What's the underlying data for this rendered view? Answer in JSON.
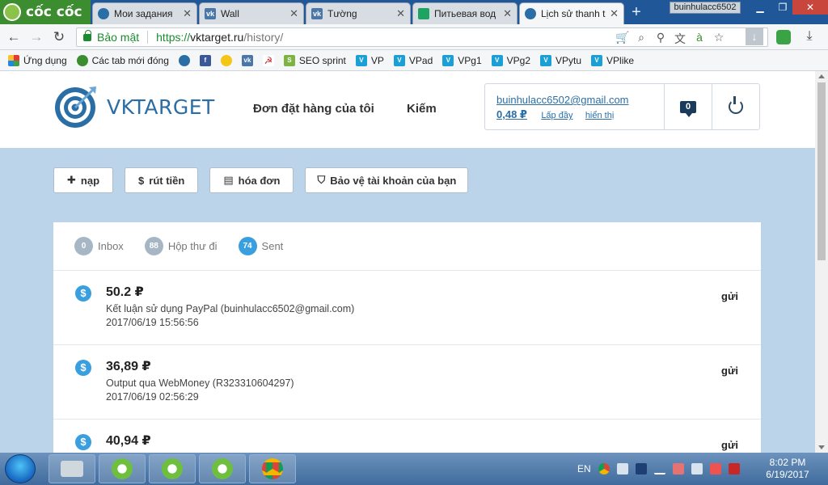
{
  "browser": {
    "logo_text": "cốc cốc",
    "tabs": [
      {
        "title": "Мои задания",
        "icon": "vktarget-icon"
      },
      {
        "title": "Wall",
        "icon": "vk-icon"
      },
      {
        "title": "Tường",
        "icon": "vk-icon"
      },
      {
        "title": "Питьевая вод",
        "icon": "sheets-icon"
      },
      {
        "title": "Lịch sử thanh t",
        "icon": "vktarget-icon"
      }
    ],
    "profile": "buinhulacc6502",
    "secure_label": "Bảo mật",
    "url_scheme": "https://",
    "url_host": "vktarget.ru",
    "url_path": "/history/"
  },
  "bookmarks": [
    {
      "label": "Ứng dụng",
      "icon": "apps-icon"
    },
    {
      "label": "Các tab mới đóng",
      "icon": "recent-tabs-icon"
    },
    {
      "label": "",
      "icon": "vktarget-icon"
    },
    {
      "label": "",
      "icon": "facebook-icon"
    },
    {
      "label": "",
      "icon": "yellow-app-icon"
    },
    {
      "label": "",
      "icon": "vk-icon"
    },
    {
      "label": "",
      "icon": "hammer-sickle-icon"
    },
    {
      "label": "SEO sprint",
      "icon": "seosprint-icon"
    },
    {
      "label": "VP",
      "icon": "v-icon"
    },
    {
      "label": "VPad",
      "icon": "v-icon"
    },
    {
      "label": "VPg1",
      "icon": "v-icon"
    },
    {
      "label": "VPg2",
      "icon": "v-icon"
    },
    {
      "label": "VPytu",
      "icon": "v-icon"
    },
    {
      "label": "VPlike",
      "icon": "v-icon"
    }
  ],
  "site": {
    "brand": "VKTARGET",
    "nav": [
      "Đơn đặt hàng của tôi",
      "Kiếm"
    ],
    "account": {
      "email": "buinhulacc6502@gmail.com",
      "balance": "0,48 ₽",
      "topup": "Lấp đầy",
      "show": "hiển thị",
      "messages": "0"
    },
    "actions": [
      {
        "label": "nạp",
        "icon": "plus-icon"
      },
      {
        "label": "rút tiền",
        "icon": "dollar-icon"
      },
      {
        "label": "hóa đơn",
        "icon": "document-icon"
      },
      {
        "label": "Bảo vệ tài khoản của bạn",
        "icon": "shield-icon"
      }
    ],
    "filters": [
      {
        "label": "Inbox",
        "count": "0",
        "color": "#a7b6c4"
      },
      {
        "label": "Hộp thư đi",
        "count": "88",
        "color": "#a7b6c4"
      },
      {
        "label": "Sent",
        "count": "74",
        "color": "#3a9fde"
      }
    ],
    "transactions": [
      {
        "amount": "50.2 ₽",
        "desc": "Kết luận sử dụng PayPal (buinhulacc6502@gmail.com)",
        "date": "2017/06/19 15:56:56",
        "status": "gửi"
      },
      {
        "amount": "36,89 ₽",
        "desc": "Output qua WebMoney (R323310604297)",
        "date": "2017/06/19 02:56:29",
        "status": "gửi"
      },
      {
        "amount": "40,94 ₽",
        "desc": "",
        "date": "",
        "status": "gửi"
      }
    ]
  },
  "taskbar": {
    "lang": "EN",
    "time": "8:02 PM",
    "date": "6/19/2017"
  },
  "colors": {
    "brand_blue": "#2b6ea6",
    "page_bg": "#bcd4ea",
    "accent": "#3a9fde"
  }
}
